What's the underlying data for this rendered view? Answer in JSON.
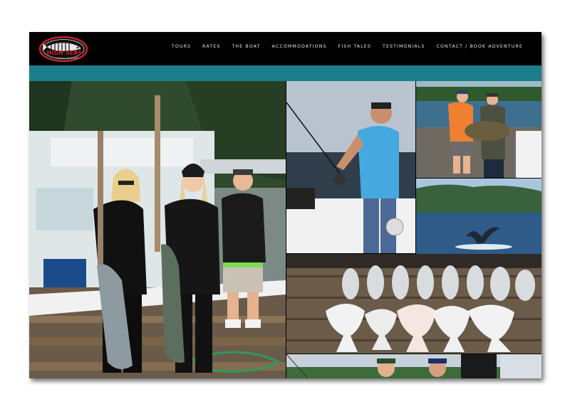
{
  "logo": {
    "brand_text": "HIGH SEAS",
    "tagline": "FISHING CHARTERS",
    "icon": "fish-skeleton-logo"
  },
  "nav": {
    "items": [
      "TOURS",
      "RATES",
      "THE BOAT",
      "ACCOMMODATIONS",
      "FISH TALES",
      "TESTIMONIALS",
      "CONTACT / BOOK ADVENTURE"
    ]
  },
  "colors": {
    "header_bg": "#000000",
    "accent_bar": "#1a7f8b",
    "nav_text": "#e8e8e8",
    "logo_red": "#c8202a"
  },
  "gallery": [
    {
      "name": "photo-girls-with-salmon"
    },
    {
      "name": "photo-man-reeling"
    },
    {
      "name": "photo-men-with-halibut"
    },
    {
      "name": "photo-whale-tail"
    },
    {
      "name": "photo-halibut-on-dock"
    },
    {
      "name": "photo-group-on-boat"
    }
  ]
}
